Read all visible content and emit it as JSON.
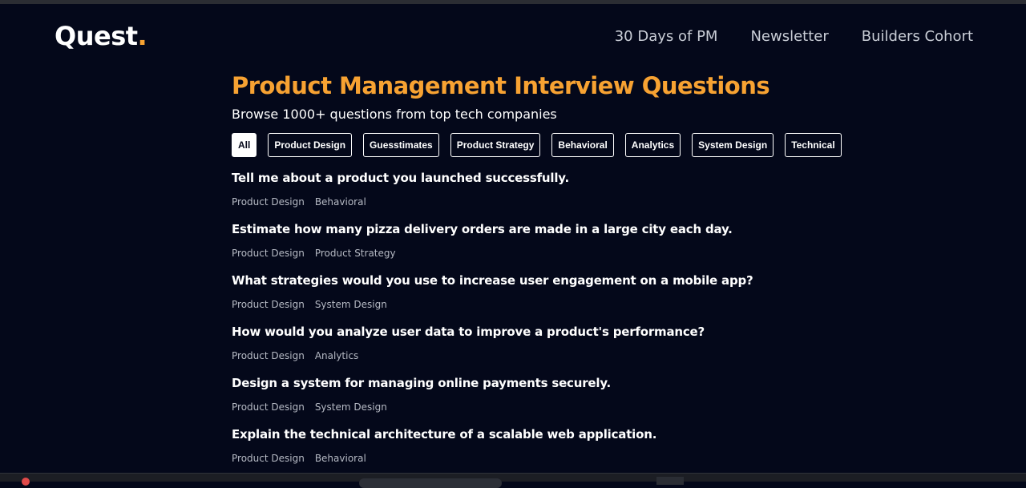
{
  "header": {
    "logo_text": "Quest",
    "logo_dot": ".",
    "nav": [
      {
        "label": "30 Days of PM"
      },
      {
        "label": "Newsletter"
      },
      {
        "label": "Builders Cohort"
      }
    ]
  },
  "main": {
    "title": "Product Management Interview Questions",
    "subtitle": "Browse 1000+ questions from top tech companies",
    "filters": [
      {
        "label": "All",
        "active": true
      },
      {
        "label": "Product Design",
        "active": false
      },
      {
        "label": "Guesstimates",
        "active": false
      },
      {
        "label": "Product Strategy",
        "active": false
      },
      {
        "label": "Behavioral",
        "active": false
      },
      {
        "label": "Analytics",
        "active": false
      },
      {
        "label": "System Design",
        "active": false
      },
      {
        "label": "Technical",
        "active": false
      }
    ],
    "questions": [
      {
        "text": "Tell me about a product you launched successfully.",
        "tags": [
          "Product Design",
          "Behavioral"
        ]
      },
      {
        "text": "Estimate how many pizza delivery orders are made in a large city each day.",
        "tags": [
          "Product Design",
          "Product Strategy"
        ]
      },
      {
        "text": "What strategies would you use to increase user engagement on a mobile app?",
        "tags": [
          "Product Design",
          "System Design"
        ]
      },
      {
        "text": "How would you analyze user data to improve a product's performance?",
        "tags": [
          "Product Design",
          "Analytics"
        ]
      },
      {
        "text": "Design a system for managing online payments securely.",
        "tags": [
          "Product Design",
          "System Design"
        ]
      },
      {
        "text": "Explain the technical architecture of a scalable web application.",
        "tags": [
          "Product Design",
          "Behavioral"
        ]
      }
    ]
  },
  "colors": {
    "background": "#04081a",
    "accent": "#f7a232",
    "text": "#ffffff",
    "muted": "#b6bac4"
  }
}
